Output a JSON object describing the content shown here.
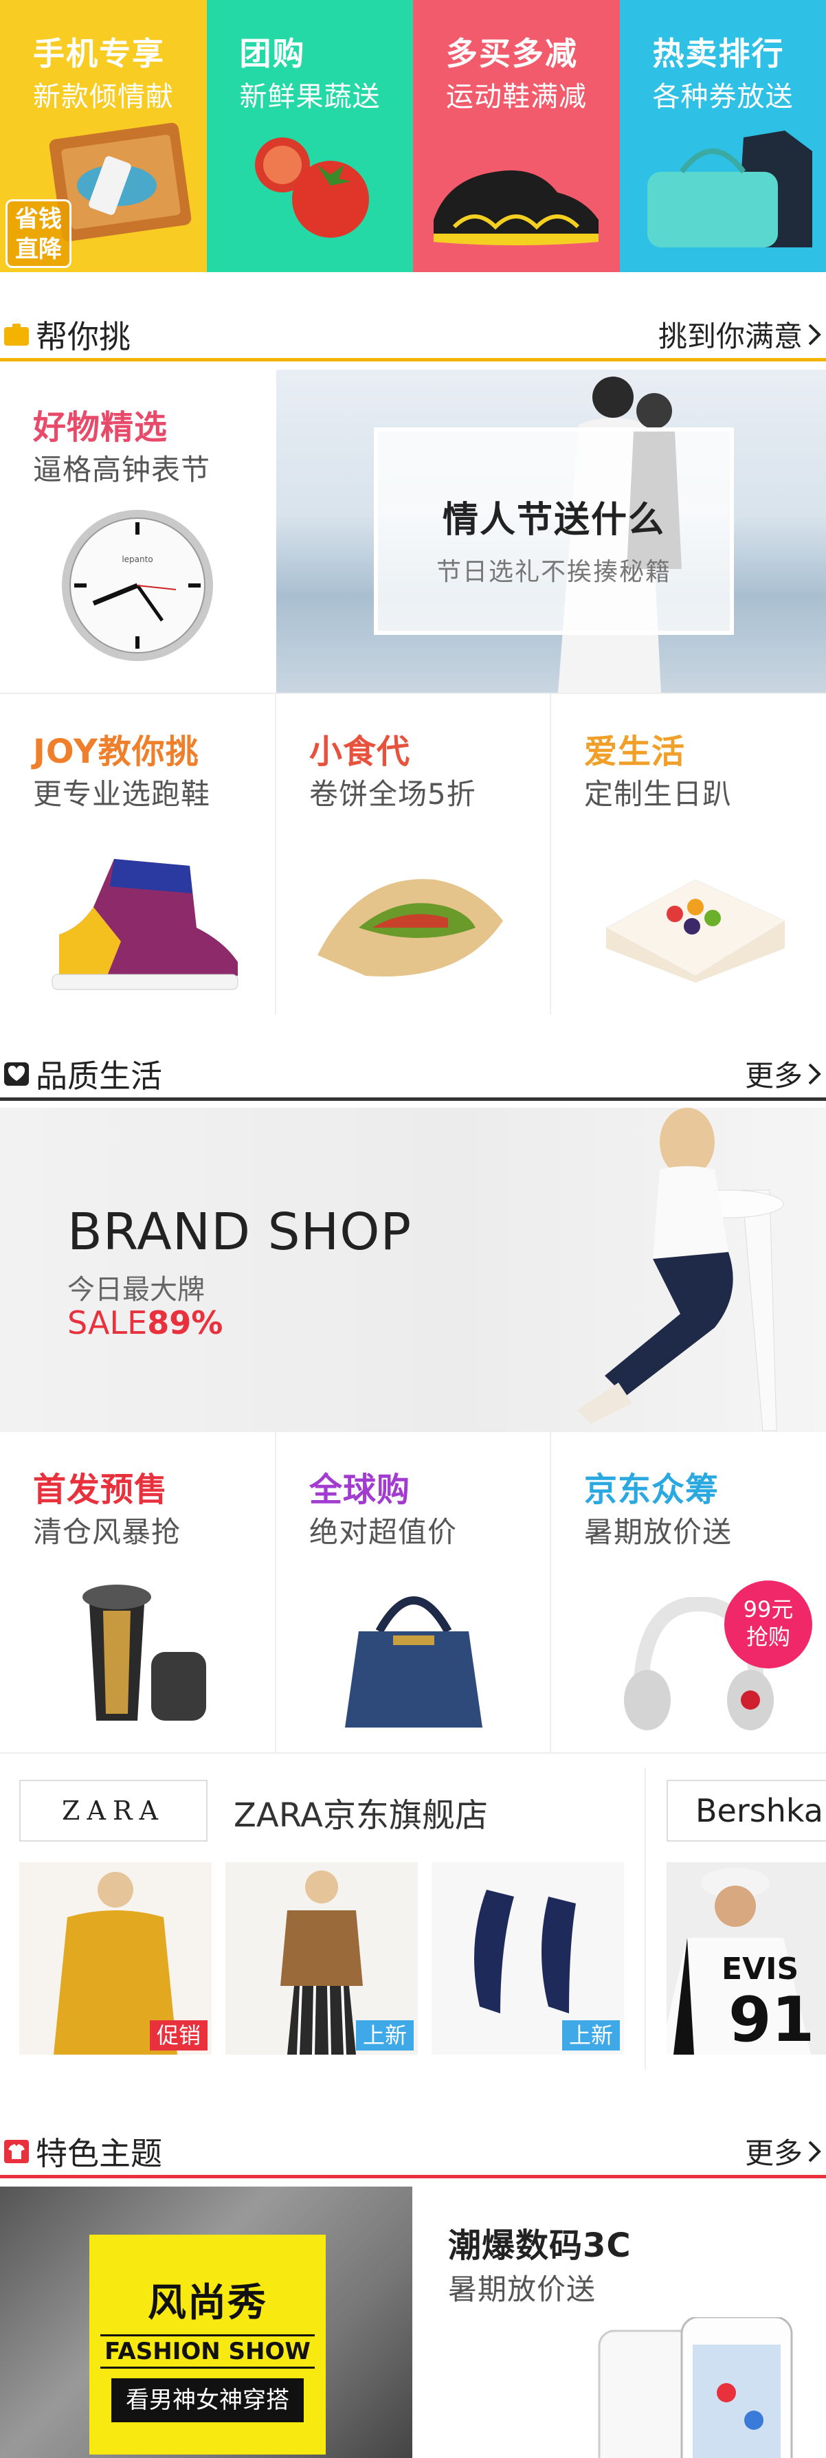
{
  "promos": [
    {
      "title": "手机专享",
      "subtitle": "新款倾情献",
      "color": "#f8cc22",
      "badge": "省钱直降"
    },
    {
      "title": "团购",
      "subtitle": "新鲜果蔬送",
      "color": "#25d9a6"
    },
    {
      "title": "多买多减",
      "subtitle": "运动鞋满减",
      "color": "#f25b6c"
    },
    {
      "title": "热卖排行",
      "subtitle": "各种券放送",
      "color": "#2fc0e6"
    }
  ],
  "sections": {
    "pick": {
      "title": "帮你挑",
      "more": "挑到你满意",
      "color": "#f4b300"
    },
    "quality": {
      "title": "品质生活",
      "more": "更多",
      "color": "#333333"
    },
    "theme": {
      "title": "特色主题",
      "more": "更多",
      "color": "#e8313c"
    }
  },
  "pick_cells": {
    "goods": {
      "title": "好物精选",
      "subtitle": "逼格高钟表节",
      "color": "#e84a6a"
    },
    "valentine": {
      "title": "情人节送什么",
      "subtitle": "节日选礼不挨揍秘籍"
    },
    "joy": {
      "title": "JOY教你挑",
      "subtitle": "更专业选跑鞋",
      "color": "#ef7f2a"
    },
    "snack": {
      "title": "小食代",
      "subtitle": "卷饼全场5折",
      "color": "#e8513c"
    },
    "life": {
      "title": "爱生活",
      "subtitle": "定制生日趴",
      "color": "#f0a028"
    }
  },
  "clock_brand": "lepanto",
  "brand_shop": {
    "title": "BRAND SHOP",
    "subtitle": "今日最大牌",
    "sale_prefix": "SALE",
    "sale_value": "89%"
  },
  "quality_cells": [
    {
      "title": "首发预售",
      "subtitle": "清仓风暴抢",
      "color": "#e8313c"
    },
    {
      "title": "全球购",
      "subtitle": "绝对超值价",
      "color": "#a23bd0"
    },
    {
      "title": "京东众筹",
      "subtitle": "暑期放价送",
      "color": "#2aa8e0",
      "badge_price": "99元",
      "badge_label": "抢购"
    }
  ],
  "stores": {
    "zara_logo": "ZARA",
    "zara_name": "ZARA京东旗舰店",
    "bershka_logo": "Bershka",
    "products": [
      {
        "tag": "促销",
        "tag_color": "#e8313c"
      },
      {
        "tag": "上新",
        "tag_color": "#3fa9e8"
      },
      {
        "tag": "上新",
        "tag_color": "#3fa9e8"
      }
    ],
    "shirt_text": "EVIS",
    "shirt_number": "91"
  },
  "theme_cells": {
    "fashion": {
      "title": "风尚秀",
      "en": "FASHION SHOW",
      "tagline": "看男神女神穿搭"
    },
    "digital": {
      "title": "潮爆数码3C",
      "subtitle": "暑期放价送"
    }
  }
}
